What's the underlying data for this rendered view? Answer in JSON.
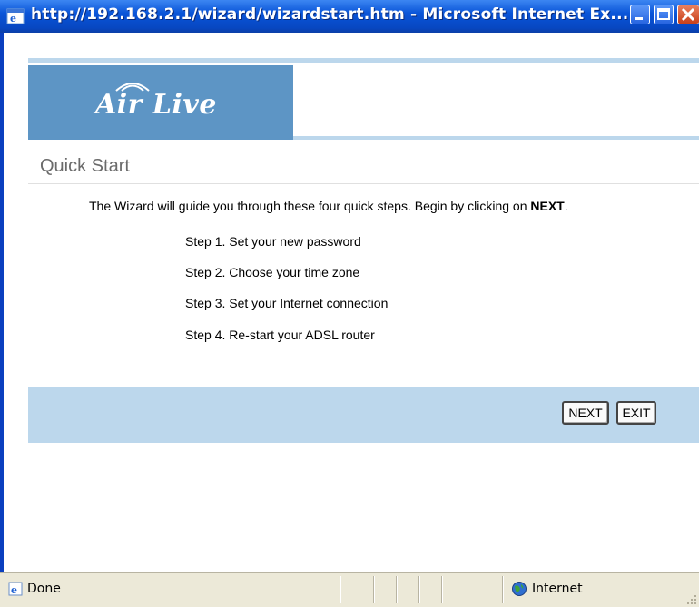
{
  "window": {
    "title": "http://192.168.2.1/wizard/wizardstart.htm - Microsoft Internet Ex...",
    "title_color": "#0a55d8"
  },
  "header": {
    "logo_text": "Air Live",
    "brand_color": "#5d95c5",
    "accent_color": "#bcd7ec"
  },
  "page": {
    "title": "Quick Start",
    "intro_prefix": "The Wizard will guide you through these four quick steps. Begin by clicking on ",
    "intro_bold": "NEXT",
    "intro_suffix": ".",
    "steps": [
      "Step 1. Set your new password",
      "Step 2. Choose your time zone",
      "Step 3. Set your Internet connection",
      "Step 4. Re-start your ADSL router"
    ]
  },
  "buttons": {
    "next_label": "NEXT",
    "exit_label": "EXIT"
  },
  "statusbar": {
    "status_text": "Done",
    "zone_text": "Internet"
  },
  "icons": {
    "title_icon": "ie-icon",
    "status_icon": "page-done-icon",
    "zone_icon": "globe-icon"
  }
}
